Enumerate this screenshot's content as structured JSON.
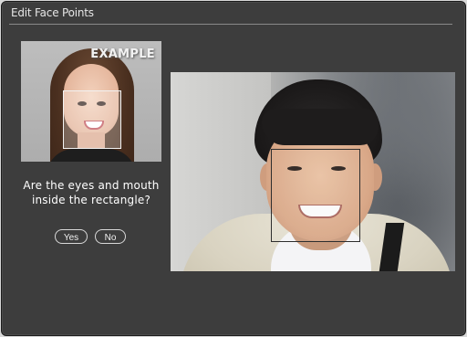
{
  "dialog": {
    "title": "Edit Face Points"
  },
  "example": {
    "label": "EXAMPLE"
  },
  "prompt": {
    "question": "Are the eyes and mouth inside the rectangle?"
  },
  "buttons": {
    "yes_label": "Yes",
    "no_label": "No"
  },
  "colors": {
    "dialog_bg": "#3d3d3d",
    "text": "#ffffff",
    "rule": "#8a8a8a"
  }
}
